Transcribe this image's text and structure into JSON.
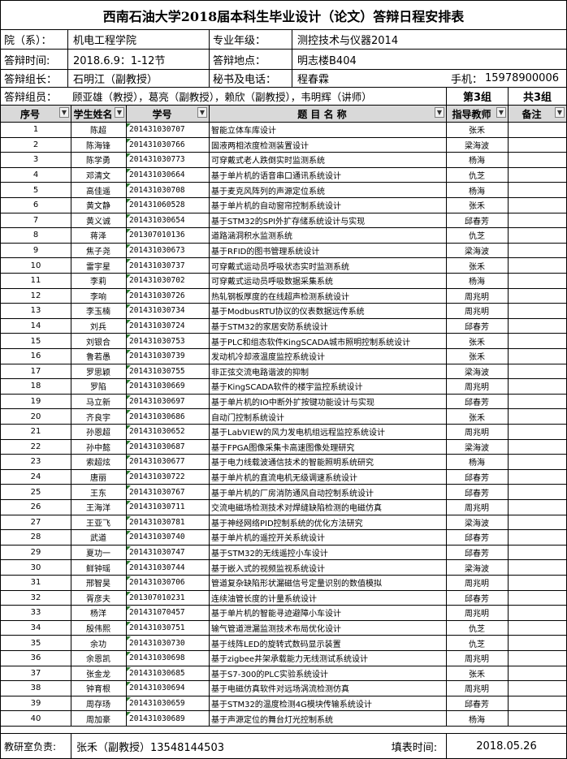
{
  "title": "西南石油大学2018届本科生毕业设计（论文）答辩日程安排表",
  "info": {
    "college_label": "院（系）：",
    "college_value": "机电工程学院",
    "major_label": "专业年级：",
    "major_value": "测控技术与仪器2014",
    "time_label": "答辩时间:",
    "time_value": "2018.6.9：1-12节",
    "place_label": "答辩地点：",
    "place_value": "明志楼B404",
    "leader_label": "答辩组长：",
    "leader_value": "石明江（副教授）",
    "secretary_label": "秘书及电话：",
    "secretary_value": "程春霖",
    "phone_label": "手机：",
    "phone_value": "15978900006",
    "members_label": "答辩组员：",
    "members_value": "顾亚雄（教授），葛亮（副教授），赖欣（副教授），韦明辉（讲师）",
    "group_no": "第3组",
    "group_total": "共3组"
  },
  "table": {
    "headers": [
      "序号",
      "学生姓名",
      "学号",
      "题 目 名 称",
      "指导教师",
      "备注"
    ],
    "rows": [
      [
        "1",
        "陈超",
        "201431030707",
        "智能立体车库设计",
        "张禾"
      ],
      [
        "2",
        "陈海锋",
        "201431030766",
        "固液两相浓度检测装置设计",
        "梁海波"
      ],
      [
        "3",
        "陈学勇",
        "201431030773",
        "可穿戴式老人跌倒实时监测系统",
        "杨海"
      ],
      [
        "4",
        "邓清文",
        "201431030664",
        "基于单片机的语音串口通讯系统设计",
        "仇芝"
      ],
      [
        "5",
        "高佳遥",
        "201431030708",
        "基于麦克风阵列的声源定位系统",
        "杨海"
      ],
      [
        "6",
        "黄文静",
        "201431060528",
        "基于单片机的自动窗帘控制系统设计",
        "张禾"
      ],
      [
        "7",
        "黄义诚",
        "201431030654",
        "基于STM32的SPI外扩存储系统设计与实现",
        "邱春芳"
      ],
      [
        "8",
        "蒋泽",
        "201307010136",
        "道路涵洞积水监测系统",
        "仇芝"
      ],
      [
        "9",
        "焦子尧",
        "201431030673",
        "基于RFID的图书管理系统设计",
        "梁海波"
      ],
      [
        "10",
        "雷宇星",
        "201431030737",
        "可穿戴式运动员呼吸状态实时监测系统",
        "张禾"
      ],
      [
        "11",
        "李莉",
        "201431030702",
        "可穿戴式运动员呼吸数据采集系统",
        "杨海"
      ],
      [
        "12",
        "李响",
        "201431030726",
        "热轧钢板厚度的在线超声检测系统设计",
        "周兆明"
      ],
      [
        "13",
        "李玉楠",
        "201431030734",
        "基于ModbusRTU协议的仪表数据远传系统",
        "周兆明"
      ],
      [
        "14",
        "刘兵",
        "201431030724",
        "基于STM32的家居安防系统设计",
        "邱春芳"
      ],
      [
        "15",
        "刘银合",
        "201431030753",
        "基于PLC和组态软件KingSCADA城市照明控制系统设计",
        "张禾"
      ],
      [
        "16",
        "鲁若愚",
        "201431030739",
        "发动机冷却液温度监控系统设计",
        "张禾"
      ],
      [
        "17",
        "罗思颖",
        "201431030755",
        "非正弦交流电路谐波的抑制",
        "梁海波"
      ],
      [
        "18",
        "罗陷",
        "201431030669",
        "基于KingSCADA软件的楼宇监控系统设计",
        "周兆明"
      ],
      [
        "19",
        "马立新",
        "201431030697",
        "基于单片机的IO中断外扩按键功能设计与实现",
        "邱春芳"
      ],
      [
        "20",
        "齐良宇",
        "201431030686",
        "自动门控制系统设计",
        "张禾"
      ],
      [
        "21",
        "孙恩超",
        "201431030652",
        "基于LabVIEW的风力发电机组远程监控系统设计",
        "周兆明"
      ],
      [
        "22",
        "孙中懿",
        "201431030687",
        "基于FPGA图像采集卡高速图像处理研究",
        "梁海波"
      ],
      [
        "23",
        "索超炫",
        "201431030677",
        "基于电力线载波通信技术的智能照明系统研究",
        "杨海"
      ],
      [
        "24",
        "唐丽",
        "201431030722",
        "基于单片机的直流电机无级调速系统设计",
        "邱春芳"
      ],
      [
        "25",
        "王东",
        "201431030767",
        "基于单片机的厂房消防通风自动控制系统设计",
        "邱春芳"
      ],
      [
        "26",
        "王海洋",
        "201431030711",
        "交流电磁场检测技术对焊缝缺陷检测的电磁仿真",
        "周兆明"
      ],
      [
        "27",
        "王亚飞",
        "201431030781",
        "基于神经网络PID控制系统的优化方法研究",
        "梁海波"
      ],
      [
        "28",
        "武道",
        "201431030740",
        "基于单片机的遥控开关系统设计",
        "邱春芳"
      ],
      [
        "29",
        "夏功一",
        "201431030747",
        "基于STM32的无线遥控小车设计",
        "邱春芳"
      ],
      [
        "30",
        "鲜钟瑶",
        "201431030744",
        "基于嵌入式的视频监视系统设计",
        "梁海波"
      ],
      [
        "31",
        "邢智昊",
        "201431030706",
        "管道复杂缺陷形状漏磁信号定量识别的数值模拟",
        "周兆明"
      ],
      [
        "32",
        "胥彦夫",
        "201307010231",
        "连续油管长度的计量系统设计",
        "邱春芳"
      ],
      [
        "33",
        "杨洋",
        "201431070457",
        "基于单片机的智能寻迹避障小车设计",
        "周兆明"
      ],
      [
        "34",
        "殷伟熙",
        "201431030751",
        "输气管道泄漏监测技术布局优化设计",
        "仇芝"
      ],
      [
        "35",
        "余功",
        "201431030730",
        "基于线阵LED的旋转式数码显示装置",
        "仇芝"
      ],
      [
        "36",
        "余恩凯",
        "201431030698",
        "基于zigbee井架承载能力无线测试系统设计",
        "周兆明"
      ],
      [
        "37",
        "张金龙",
        "201431030685",
        "基于S7-300的PLC实验系统设计",
        "张禾"
      ],
      [
        "38",
        "钟育根",
        "201431030694",
        "基于电磁仿真软件对远场涡流检测仿真",
        "周兆明"
      ],
      [
        "39",
        "周存玚",
        "201431030659",
        "基于STM32的温度检测4G模块传输系统设计",
        "邱春芳"
      ],
      [
        "40",
        "周加豪",
        "201431030689",
        "基于声源定位的舞台灯光控制系统",
        "杨海"
      ]
    ]
  },
  "footer": {
    "office_label": "教研室负责:",
    "office_value": "张禾（副教授）13548144503",
    "date_label": "填表时间:",
    "date_value": "2018.05.26"
  },
  "icons": {
    "filter": "dropdown-arrow-icon",
    "marker": "green-corner-triangle-icon"
  },
  "colors": {
    "header_bg": "#d9d9d9",
    "marker": "#2e7d32"
  }
}
